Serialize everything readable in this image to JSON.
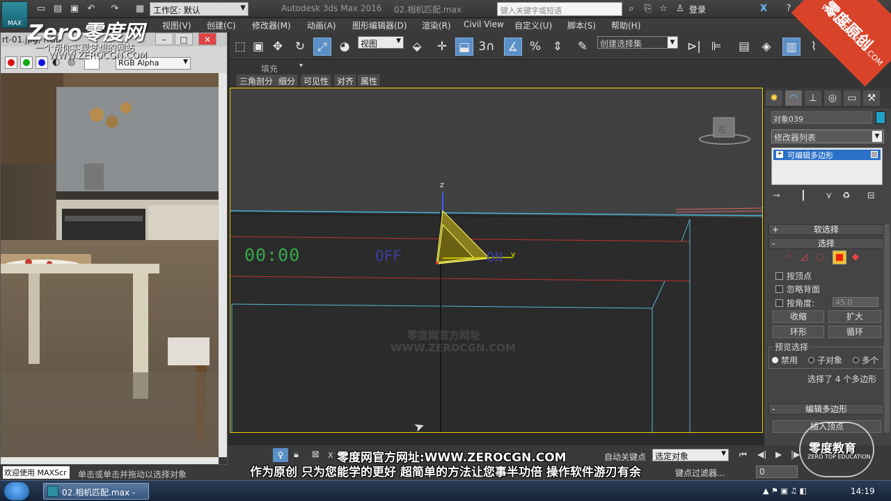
{
  "app": {
    "logo_label": "MAX",
    "workspace": "工作区: 默认",
    "title": "Autodesk 3ds Max 2016",
    "file": "02.相机匹配.max",
    "search_placeholder": "键入关键字或短语",
    "login": "登录",
    "close_glyph": "X"
  },
  "menu": [
    "视图(V)",
    "创建(C)",
    "修改器(M)",
    "动画(A)",
    "图形编辑器(D)",
    "渲染(R)",
    "Civil View",
    "自定义(U)",
    "脚本(S)",
    "帮助(H)"
  ],
  "toolbar": {
    "view_dropdown": "视图",
    "selection_set": "创建选择集",
    "snap_label": "3"
  },
  "ribbon": {
    "group_label": "填充",
    "buttons": [
      "三角剖分",
      "细分",
      "可见性",
      "对齐",
      "属性"
    ]
  },
  "image_window": {
    "title": "rt-01.jpg, RGB",
    "channel": "RGB Alpha"
  },
  "viewport": {
    "timer_text": "00:00",
    "off_text": "OFF",
    "on_text": "ON",
    "axis_z": "z",
    "axis_y": "y",
    "viewcube_label": "左",
    "watermark_site": "零度网官方网址",
    "watermark_url": "WWW.ZEROCGN.COM"
  },
  "command_panel": {
    "object_name": "对象039",
    "object_color": "#1fa3c9",
    "modifier_list": "修改器列表",
    "stack_item": "可编辑多边形",
    "rollouts": {
      "soft_selection": "软选择",
      "selection": "选择",
      "edit_polygons": "编辑多边形",
      "insert_vertex": "插入顶点"
    },
    "by_vertex": "按顶点",
    "ignore_backfacing": "忽略背面",
    "by_angle": "按角度:",
    "angle_value": "45.0",
    "shrink": "收缩",
    "grow": "扩大",
    "ring": "环形",
    "loop": "循环",
    "preview_title": "预览选择",
    "preview_options": [
      "禁用",
      "子对象",
      "多个"
    ],
    "status": "选择了 4 个多边形"
  },
  "bottom": {
    "welcome": "欢迎使用 MAXScr",
    "prompt": "单击或单击并拖动以选择对象",
    "autokey": "自动关键点",
    "selected_object": "选定对象",
    "key_filter": "键点过滤器...",
    "frame": "0",
    "x_label": "X"
  },
  "captions": {
    "url_caption": "零度网官方网址:WWW.ZEROCGN.COM",
    "subtitle": "作为原创 只为您能学的更好 超简单的方法让您事半功倍 操作软件游刃有余"
  },
  "watermark": {
    "brand": "Zero零度网",
    "slogan": "一个帮你实现梦想的网站",
    "url": "WWW.ZEROCGN.COM",
    "corner_text": "零度原创",
    "corner_url": "WWW.ZEROCGN.COM",
    "edu_logo": "零度教育",
    "edu_sub": "ZERO TOP EDUCATION"
  },
  "taskbar": {
    "task_label": "02.相机匹配.max - ...",
    "clock": "14:19"
  }
}
